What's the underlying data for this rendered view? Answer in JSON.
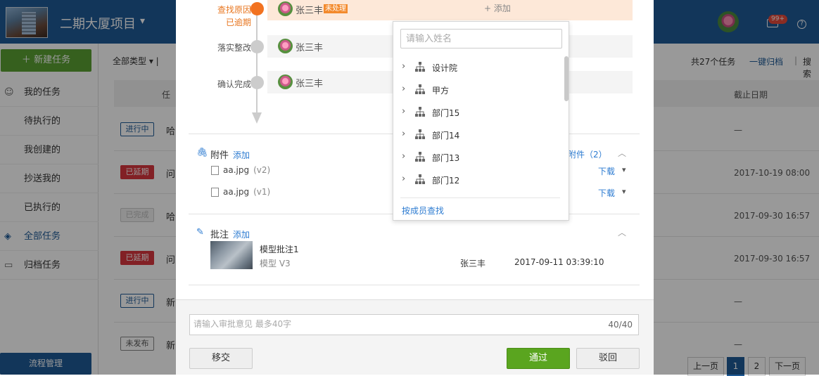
{
  "app": {
    "project_title": "二期大厦项目",
    "mail_badge": "99+",
    "help_glyph": "?"
  },
  "sidebar": {
    "new_task": "新建任务",
    "items": [
      {
        "label": "我的任务",
        "icon": "user-icon"
      },
      {
        "label": "待执行的"
      },
      {
        "label": "我创建的"
      },
      {
        "label": "抄送我的"
      },
      {
        "label": "已执行的"
      },
      {
        "label": "全部任务",
        "icon": "layers-icon"
      },
      {
        "label": "归档任务",
        "icon": "archive-icon"
      }
    ],
    "flow_manage": "流程管理"
  },
  "main": {
    "filter": "全部类型",
    "task_count": "共27个任务",
    "archive_all": "一键归档",
    "search": "搜索",
    "col_task": "任",
    "col_due": "截止日期",
    "rows": [
      {
        "status": "进行中",
        "text": "哈",
        "due": "—"
      },
      {
        "status": "已延期",
        "text": "问",
        "due": "2017-10-19 08:00"
      },
      {
        "status": "已完成",
        "text": "哈",
        "due": "2017-09-30 16:57"
      },
      {
        "status": "已延期",
        "text": "问",
        "due": "2017-09-30 16:57"
      },
      {
        "status": "进行中",
        "text": "新",
        "due": "—"
      },
      {
        "status": "未发布",
        "text": "新",
        "due": "—"
      }
    ],
    "pager": {
      "prev": "上一页",
      "pages": [
        "1",
        "2"
      ],
      "next": "下一页"
    }
  },
  "modal": {
    "workflow": [
      {
        "label": "查找原因",
        "sub": "已逾期",
        "user": "张三丰",
        "status": "未处理",
        "current": true
      },
      {
        "label": "落实整改",
        "user": "张三丰"
      },
      {
        "label": "确认完成",
        "user": "张三丰"
      }
    ],
    "add_assignee": "+ 添加",
    "attachments": {
      "title": "附件",
      "add": "添加",
      "count_label": "附件（2）",
      "files": [
        {
          "name": "aa.jpg",
          "version": "(v2)",
          "action": "下载"
        },
        {
          "name": "aa.jpg",
          "version": "(v1)",
          "action": "下载"
        }
      ]
    },
    "annotations": {
      "title": "批注",
      "add": "添加",
      "items": [
        {
          "title": "模型批注1",
          "meta": "模型  V3",
          "user": "张三丰",
          "time": "2017-09-11 03:39:10"
        }
      ]
    },
    "opinion": {
      "placeholder": "请输入审批意见 最多40字",
      "count": "40/40"
    },
    "buttons": {
      "transfer": "移交",
      "pass": "通过",
      "reject": "驳回"
    }
  },
  "dropdown": {
    "search_placeholder": "请输入姓名",
    "items": [
      "设计院",
      "甲方",
      "部门15",
      "部门14",
      "部门13",
      "部门12"
    ],
    "member_search": "按成员查找"
  }
}
